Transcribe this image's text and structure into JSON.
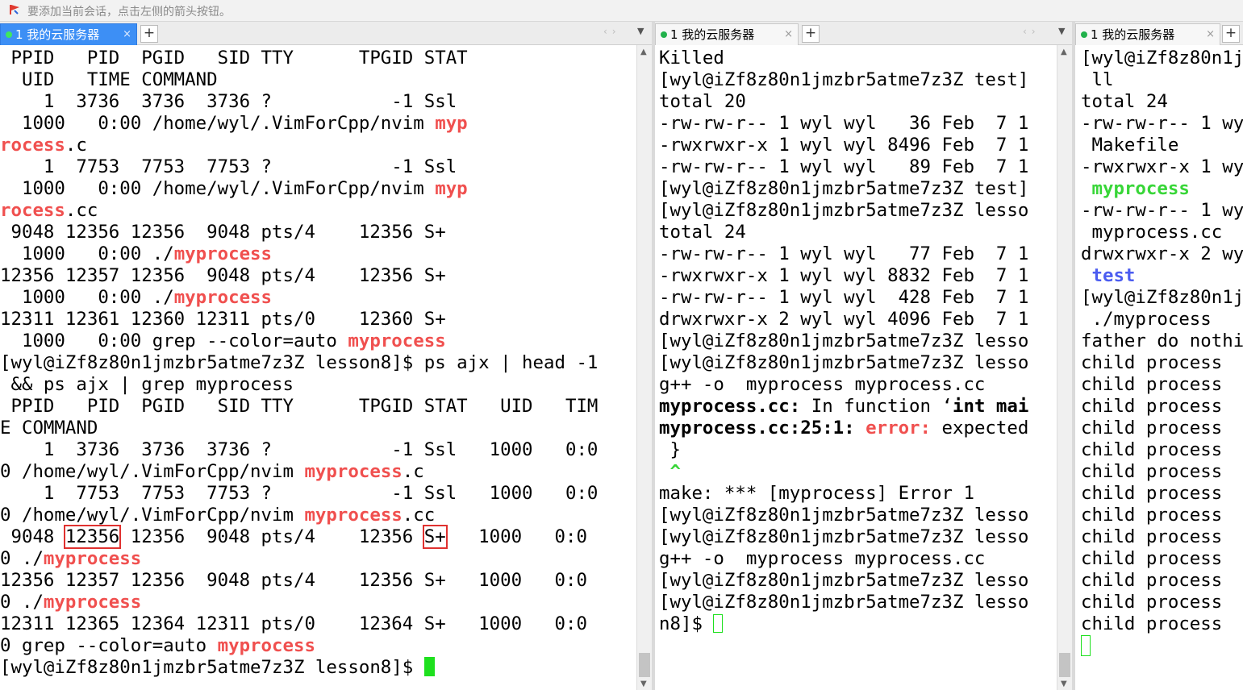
{
  "topbar": {
    "hint": "要添加当前会话，点击左侧的箭头按钮。"
  },
  "panes": [
    {
      "tab_label": "1 我的云服务器"
    },
    {
      "tab_label": "1 我的云服务器"
    },
    {
      "tab_label": "1 我的云服务器"
    }
  ],
  "tab_close_glyph": "×",
  "tab_add_glyph": "+",
  "colors": {
    "prompt_highlight": "#f0504f",
    "cursor": "#1ee01e",
    "active_tab": "#3d8ff5",
    "exec_file": "#38d638",
    "dir": "#4b5cf0"
  },
  "term1": {
    "l01": " PPID   PID  PGID   SID TTY      TPGID STAT",
    "l02": "  UID   TIME COMMAND",
    "l03": "    1  3736  3736  3736 ?           -1 Ssl",
    "l04a": "  1000   0:00 /home/wyl/.VimForCpp/nvim ",
    "l04b": "myp",
    "l05a": "rocess",
    "l05b": ".c",
    "l06": "    1  7753  7753  7753 ?           -1 Ssl",
    "l07a": "  1000   0:00 /home/wyl/.VimForCpp/nvim ",
    "l07b": "myp",
    "l08a": "rocess",
    "l08b": ".cc",
    "l09": " 9048 12356 12356  9048 pts/4    12356 S+",
    "l10a": "  1000   0:00 ./",
    "l10b": "myprocess",
    "l11": "12356 12357 12356  9048 pts/4    12356 S+",
    "l12a": "  1000   0:00 ./",
    "l12b": "myprocess",
    "l13": "12311 12361 12360 12311 pts/0    12360 S+",
    "l14a": "  1000   0:00 grep --color=auto ",
    "l14b": "myprocess",
    "l15": "[wyl@iZf8z80n1jmzbr5atme7z3Z lesson8]$ ps ajx | head -1",
    "l16": " && ps ajx | grep myprocess",
    "l17": " PPID   PID  PGID   SID TTY      TPGID STAT   UID   TIM",
    "l18": "E COMMAND",
    "l19": "    1  3736  3736  3736 ?           -1 Ssl   1000   0:0",
    "l20a": "0 /home/wyl/.VimForCpp/nvim ",
    "l20b": "myprocess",
    "l20c": ".c",
    "l21": "    1  7753  7753  7753 ?           -1 Ssl   1000   0:0",
    "l22a": "0 /home/wyl/.VimForCpp/nvim ",
    "l22b": "myprocess",
    "l22c": ".cc",
    "l23a": " 9048 ",
    "l23b": "12356",
    "l23c": " 12356  9048 pts/4    12356 ",
    "l23d": "S+",
    "l23e": "   1000   0:0",
    "l24a": "0 ./",
    "l24b": "myprocess",
    "l25": "12356 12357 12356  9048 pts/4    12356 S+   1000   0:0",
    "l26a": "0 ./",
    "l26b": "myprocess",
    "l27": "12311 12365 12364 12311 pts/0    12364 S+   1000   0:0",
    "l28a": "0 grep --color=auto ",
    "l28b": "myprocess",
    "l29": "[wyl@iZf8z80n1jmzbr5atme7z3Z lesson8]$ "
  },
  "term2": {
    "l01": "Killed",
    "l02": "[wyl@iZf8z80n1jmzbr5atme7z3Z test]",
    "l03": "total 20",
    "l04": "-rw-rw-r-- 1 wyl wyl   36 Feb  7 1",
    "l05": "-rwxrwxr-x 1 wyl wyl 8496 Feb  7 1",
    "l06": "-rw-rw-r-- 1 wyl wyl   89 Feb  7 1",
    "l07": "[wyl@iZf8z80n1jmzbr5atme7z3Z test]",
    "l08": "[wyl@iZf8z80n1jmzbr5atme7z3Z lesso",
    "l09": "total 24",
    "l10": "-rw-rw-r-- 1 wyl wyl   77 Feb  7 1",
    "l11": "-rwxrwxr-x 1 wyl wyl 8832 Feb  7 1",
    "l12": "-rw-rw-r-- 1 wyl wyl  428 Feb  7 1",
    "l13": "drwxrwxr-x 2 wyl wyl 4096 Feb  7 1",
    "l14": "[wyl@iZf8z80n1jmzbr5atme7z3Z lesso",
    "l15": "[wyl@iZf8z80n1jmzbr5atme7z3Z lesso",
    "l16": "g++ -o  myprocess myprocess.cc",
    "l17a": "myprocess.cc:",
    "l17b": " In function ‘",
    "l17c": "int mai",
    "l18a": "myprocess.cc:25:1:",
    "l18b": " ",
    "l18c": "error:",
    "l18d": " expected",
    "l19": " }",
    "l20": " ^",
    "l21": "make: *** [myprocess] Error 1",
    "l22": "[wyl@iZf8z80n1jmzbr5atme7z3Z lesso",
    "l23": "[wyl@iZf8z80n1jmzbr5atme7z3Z lesso",
    "l24": "g++ -o  myprocess myprocess.cc",
    "l25": "[wyl@iZf8z80n1jmzbr5atme7z3Z lesso",
    "l26": "[wyl@iZf8z80n1jmzbr5atme7z3Z lesso",
    "l27": "n8]$ "
  },
  "term3": {
    "l01": "[wyl@iZf8z80n1j",
    "l02": " ll",
    "l03": "total 24",
    "l04": "-rw-rw-r-- 1 wy",
    "l05": " Makefile",
    "l06": "-rwxrwxr-x 1 wy",
    "l07": " myprocess",
    "l08": "-rw-rw-r-- 1 wy",
    "l09": " myprocess.cc",
    "l10": "drwxrwxr-x 2 wy",
    "l11": " test",
    "l12": "[wyl@iZf8z80n1j",
    "l13": " ./myprocess",
    "l14": "father do nothi",
    "child_line": "child process"
  }
}
